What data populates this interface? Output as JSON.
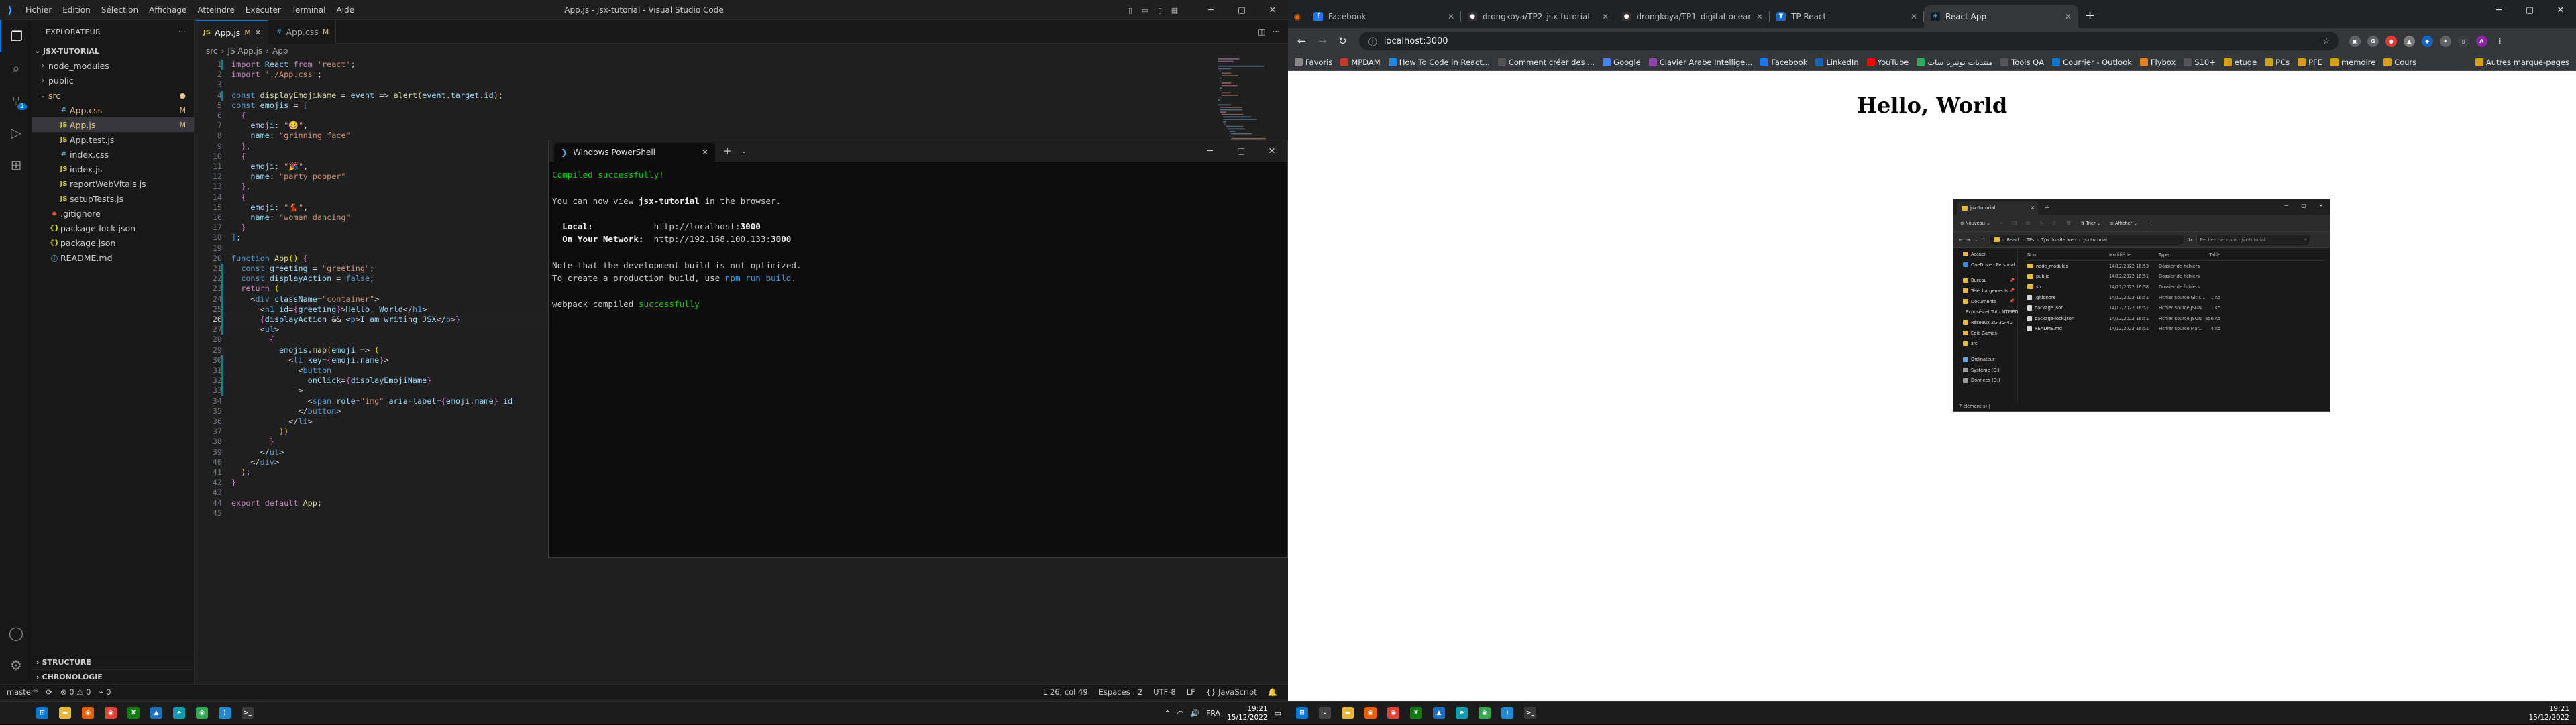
{
  "vscode": {
    "menu": [
      "Fichier",
      "Edition",
      "Sélection",
      "Affichage",
      "Atteindre",
      "Exécuter",
      "Terminal",
      "Aide"
    ],
    "title": "App.js - jsx-tutorial - Visual Studio Code",
    "explorer_title": "EXPLORATEUR",
    "project": "JSX-TUTORIAL",
    "files": [
      {
        "name": "node_modules",
        "kind": "folder",
        "depth": 0,
        "state": "",
        "open": false
      },
      {
        "name": "public",
        "kind": "folder",
        "depth": 0,
        "state": "",
        "open": false
      },
      {
        "name": "src",
        "kind": "folder",
        "depth": 0,
        "state": "dot",
        "open": true
      },
      {
        "name": "App.css",
        "kind": "css",
        "depth": 1,
        "state": "M"
      },
      {
        "name": "App.js",
        "kind": "js",
        "depth": 1,
        "state": "M"
      },
      {
        "name": "App.test.js",
        "kind": "js",
        "depth": 1,
        "state": ""
      },
      {
        "name": "index.css",
        "kind": "css",
        "depth": 1,
        "state": ""
      },
      {
        "name": "index.js",
        "kind": "js",
        "depth": 1,
        "state": ""
      },
      {
        "name": "reportWebVitals.js",
        "kind": "js",
        "depth": 1,
        "state": ""
      },
      {
        "name": "setupTests.js",
        "kind": "js",
        "depth": 1,
        "state": ""
      },
      {
        "name": ".gitignore",
        "kind": "git",
        "depth": 0,
        "state": ""
      },
      {
        "name": "package-lock.json",
        "kind": "json",
        "depth": 0,
        "state": ""
      },
      {
        "name": "package.json",
        "kind": "json",
        "depth": 0,
        "state": ""
      },
      {
        "name": "README.md",
        "kind": "md",
        "depth": 0,
        "state": ""
      }
    ],
    "bottom_sections": [
      "STRUCTURE",
      "CHRONOLOGIE"
    ],
    "tabs": [
      {
        "label": "App.js",
        "state": "M",
        "active": true
      },
      {
        "label": "App.css",
        "state": "M",
        "active": false
      }
    ],
    "breadcrumb": [
      "src",
      "JS App.js",
      "App"
    ],
    "code": [
      "import React from 'react';",
      "import './App.css';",
      "",
      "const displayEmojiName = event => alert(event.target.id);",
      "const emojis = [",
      "  {",
      "    emoji: \"😀\",",
      "    name: \"grinning face\"",
      "  },",
      "  {",
      "    emoji: \"🎉\",",
      "    name: \"party popper\"",
      "  },",
      "  {",
      "    emoji: \"💃\",",
      "    name: \"woman dancing\"",
      "  }",
      "];",
      "",
      "function App() {",
      "  const greeting = \"greeting\";",
      "  const displayAction = false;",
      "  return (",
      "    <div className=\"container\">",
      "      <h1 id={greeting}>Hello, World</h1>",
      "      {displayAction && <p>I am writing JSX</p>}",
      "      <ul>",
      "        {",
      "          emojis.map(emoji => (",
      "            <li key={emoji.name}>",
      "              <button",
      "                onClick={displayEmojiName}",
      "              >",
      "                <span role=\"img\" aria-label={emoji.name} id",
      "              </button>",
      "            </li>",
      "          ))",
      "        }",
      "      </ul>",
      "    </div>",
      "  );",
      "}",
      "",
      "export default App;",
      ""
    ],
    "status": {
      "branch": "master*",
      "sync": "⟳",
      "problems": "⊗ 0  ⚠ 0",
      "watch": "⌁ 0",
      "position": "L 26, col 49",
      "spaces": "Espaces : 2",
      "encoding": "UTF-8",
      "eol": "LF",
      "language": "{} JavaScript"
    }
  },
  "powershell": {
    "tab_title": "Windows PowerShell",
    "lines": [
      {
        "parts": [
          {
            "t": "Compiled successfully!",
            "c": "green"
          }
        ]
      },
      {
        "parts": [
          {
            "t": ""
          }
        ]
      },
      {
        "parts": [
          {
            "t": "You can now view "
          },
          {
            "t": "jsx-tutorial",
            "c": "bold"
          },
          {
            "t": " in the browser."
          }
        ]
      },
      {
        "parts": [
          {
            "t": ""
          }
        ]
      },
      {
        "parts": [
          {
            "t": "  "
          },
          {
            "t": "Local:",
            "c": "bold"
          },
          {
            "t": "            http://localhost:"
          },
          {
            "t": "3000",
            "c": "bold"
          }
        ]
      },
      {
        "parts": [
          {
            "t": "  "
          },
          {
            "t": "On Your Network:",
            "c": "bold"
          },
          {
            "t": "  http://192.168.100.133:"
          },
          {
            "t": "3000",
            "c": "bold"
          }
        ]
      },
      {
        "parts": [
          {
            "t": ""
          }
        ]
      },
      {
        "parts": [
          {
            "t": "Note that the development build is not optimized."
          }
        ]
      },
      {
        "parts": [
          {
            "t": "To create a production build, use "
          },
          {
            "t": "npm run build",
            "c": "cyan"
          },
          {
            "t": "."
          }
        ]
      },
      {
        "parts": [
          {
            "t": ""
          }
        ]
      },
      {
        "parts": [
          {
            "t": "webpack compiled "
          },
          {
            "t": "successfully",
            "c": "green"
          }
        ]
      }
    ]
  },
  "browser": {
    "tabs": [
      {
        "label": "Facebook",
        "icon": "f",
        "color": "#1877f2",
        "active": false
      },
      {
        "label": "drongkoya/TP2_jsx-tutorial",
        "icon": "●",
        "color": "#333",
        "active": false
      },
      {
        "label": "drongkoya/TP1_digital-ocean-",
        "icon": "●",
        "color": "#333",
        "active": false
      },
      {
        "label": "TP React",
        "icon": "T",
        "color": "#1b6ac9",
        "active": false
      },
      {
        "label": "React App",
        "icon": "⚛",
        "color": "#0f1f2a",
        "active": true
      }
    ],
    "url": "localhost:3000",
    "bookmarks": [
      {
        "label": "Favoris",
        "color": "#888"
      },
      {
        "label": "MPDAM",
        "color": "#c0392b"
      },
      {
        "label": "How To Code in React...",
        "color": "#1e88e5"
      },
      {
        "label": "Comment créer des ...",
        "color": "#555"
      },
      {
        "label": "Google",
        "color": "#4285f4"
      },
      {
        "label": "Clavier Arabe Intellige...",
        "color": "#8e44ad"
      },
      {
        "label": "Facebook",
        "color": "#1877f2"
      },
      {
        "label": "LinkedIn",
        "color": "#0a66c2"
      },
      {
        "label": "YouTube",
        "color": "#ff0000"
      },
      {
        "label": "منتديات تونيزيا سات",
        "color": "#27ae60"
      },
      {
        "label": "Tools QA",
        "color": "#555"
      },
      {
        "label": "Courrier - Outlook",
        "color": "#0078d4"
      },
      {
        "label": "Flybox",
        "color": "#e67e22"
      },
      {
        "label": "S10+",
        "color": "#555"
      },
      {
        "label": "etude",
        "color": "#d4a017"
      },
      {
        "label": "PCs",
        "color": "#d4a017"
      },
      {
        "label": "PFE",
        "color": "#d4a017"
      },
      {
        "label": "memoire",
        "color": "#d4a017"
      },
      {
        "label": "Cours",
        "color": "#d4a017"
      }
    ],
    "other_bookmarks": "Autres marque-pages",
    "heading": "Hello, World",
    "emojis": [
      "😀",
      "🎉",
      "💃"
    ]
  },
  "explorer": {
    "tab_title": "jsx-tutorial",
    "new_label": "Nouveau",
    "sort_label": "Trier",
    "view_label": "Afficher",
    "path": [
      "React",
      "TPs",
      "Tps du site web",
      "jsx-tutorial"
    ],
    "search_placeholder": "Rechercher dans : jsx-tutorial",
    "nav": [
      {
        "label": "Accueil",
        "type": "home"
      },
      {
        "label": "OneDrive - Personal",
        "type": "cloud"
      },
      {
        "label": "",
        "type": "sp"
      },
      {
        "label": "Bureau",
        "type": "folder",
        "pin": true
      },
      {
        "label": "Téléchargements",
        "type": "folder",
        "pin": true
      },
      {
        "label": "Documents",
        "type": "folder",
        "pin": true
      },
      {
        "label": "Exposés et Tuto MTMPD",
        "type": "folder"
      },
      {
        "label": "Réseaux 2G-3G-4G",
        "type": "folder"
      },
      {
        "label": "Epic Games",
        "type": "folder"
      },
      {
        "label": "src",
        "type": "folder"
      },
      {
        "label": "",
        "type": "sp"
      },
      {
        "label": "Ordinateur",
        "type": "pc"
      },
      {
        "label": "Système (C:)",
        "type": "drive"
      },
      {
        "label": "Données (D:)",
        "type": "drive"
      }
    ],
    "columns": [
      "Nom",
      "Modifié le",
      "Type",
      "Taille"
    ],
    "rows": [
      {
        "name": "node_modules",
        "date": "14/12/2022 16:53",
        "type": "Dossier de fichiers",
        "size": "",
        "folder": true
      },
      {
        "name": "public",
        "date": "14/12/2022 16:51",
        "type": "Dossier de fichiers",
        "size": "",
        "folder": true
      },
      {
        "name": "src",
        "date": "14/12/2022 16:58",
        "type": "Dossier de fichiers",
        "size": "",
        "folder": true
      },
      {
        "name": ".gitignore",
        "date": "14/12/2022 16:51",
        "type": "Fichier source Git I...",
        "size": "1 Ko",
        "folder": false
      },
      {
        "name": "package.json",
        "date": "14/12/2022 16:51",
        "type": "Fichier source JSON",
        "size": "1 Ko",
        "folder": false
      },
      {
        "name": "package-lock.json",
        "date": "14/12/2022 16:51",
        "type": "Fichier source JSON",
        "size": "650 Ko",
        "folder": false
      },
      {
        "name": "README.md",
        "date": "14/12/2022 16:51",
        "type": "Fichier source Mar...",
        "size": "4 Ko",
        "folder": false
      }
    ],
    "status": "7 élément(s)  |"
  },
  "taskbar_left": {
    "icons": [
      {
        "name": "start",
        "color": "#0078d4",
        "g": "⊞"
      },
      {
        "name": "file-explorer",
        "color": "#e9b73b",
        "g": "▬"
      },
      {
        "name": "firefox",
        "color": "#e66000",
        "g": "◉"
      },
      {
        "name": "chrome",
        "color": "#db4437",
        "g": "◉"
      },
      {
        "name": "xbox",
        "color": "#107c10",
        "g": "X"
      },
      {
        "name": "app-blue",
        "color": "#1f6fbf",
        "g": "▲"
      },
      {
        "name": "edge",
        "color": "#0c9cb0",
        "g": "e"
      },
      {
        "name": "chrome-2",
        "color": "#34a853",
        "g": "◉"
      },
      {
        "name": "vscode",
        "color": "#1f8ad2",
        "g": "⟩"
      },
      {
        "name": "terminal",
        "color": "#3a3a3a",
        "g": ">_"
      }
    ],
    "lang": "FRA",
    "time": "19:21",
    "date": "15/12/2022"
  },
  "taskbar_right": {
    "icons": [
      {
        "name": "start",
        "color": "#0078d4",
        "g": "⊞"
      },
      {
        "name": "search",
        "color": "#444",
        "g": "⌕"
      },
      {
        "name": "file-explorer",
        "color": "#e9b73b",
        "g": "▬"
      },
      {
        "name": "firefox",
        "color": "#e66000",
        "g": "◉"
      },
      {
        "name": "chrome",
        "color": "#db4437",
        "g": "◉"
      },
      {
        "name": "xbox",
        "color": "#107c10",
        "g": "X"
      },
      {
        "name": "app-blue",
        "color": "#1f6fbf",
        "g": "▲"
      },
      {
        "name": "edge",
        "color": "#0c9cb0",
        "g": "e"
      },
      {
        "name": "chrome-2",
        "color": "#34a853",
        "g": "◉"
      },
      {
        "name": "vscode",
        "color": "#1f8ad2",
        "g": "⟩"
      },
      {
        "name": "terminal",
        "color": "#3a3a3a",
        "g": ">_"
      }
    ],
    "time": "19:21",
    "date": "15/12/2022"
  }
}
